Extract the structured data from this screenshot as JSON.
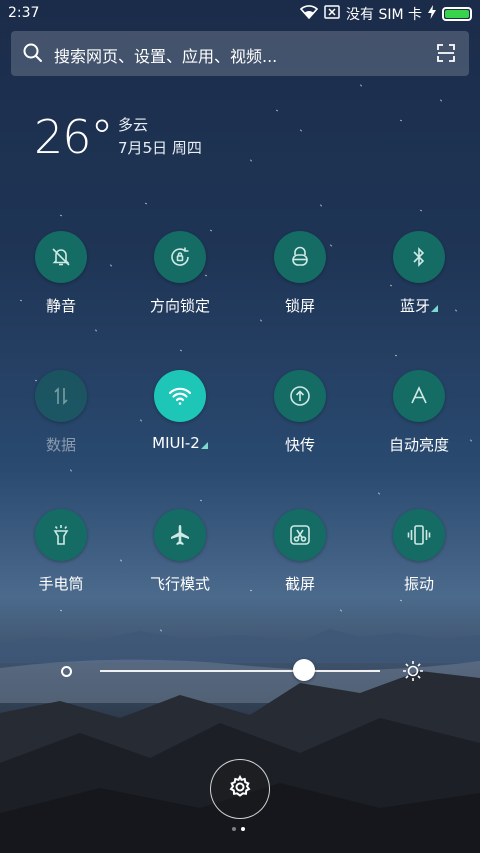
{
  "status_bar": {
    "time": "2:37",
    "sim_status": "没有 SIM 卡",
    "battery_level": 1.0,
    "icons": [
      "wifi-icon",
      "no-sim-icon",
      "charging-icon",
      "battery-icon"
    ]
  },
  "search": {
    "placeholder": "搜索网页、设置、应用、视频...",
    "icons": [
      "search-icon",
      "scan-icon"
    ]
  },
  "weather": {
    "temperature": "26°",
    "condition": "多云",
    "date": "7月5日 周四"
  },
  "toggles": [
    {
      "label": "静音",
      "icon": "silent-bell-icon",
      "state": "off"
    },
    {
      "label": "方向锁定",
      "icon": "rotation-lock-icon",
      "state": "off"
    },
    {
      "label": "锁屏",
      "icon": "lock-icon",
      "state": "off"
    },
    {
      "label": "蓝牙",
      "icon": "bluetooth-icon",
      "state": "off",
      "has_more": true
    },
    {
      "label": "数据",
      "icon": "mobile-data-icon",
      "state": "disabled"
    },
    {
      "label": "MIUI-2",
      "icon": "wifi-icon",
      "state": "on",
      "has_more": true
    },
    {
      "label": "快传",
      "icon": "quick-transfer-icon",
      "state": "off"
    },
    {
      "label": "自动亮度",
      "icon": "auto-brightness-icon",
      "state": "off"
    },
    {
      "label": "手电筒",
      "icon": "flashlight-icon",
      "state": "off"
    },
    {
      "label": "飞行模式",
      "icon": "airplane-icon",
      "state": "off"
    },
    {
      "label": "截屏",
      "icon": "screenshot-icon",
      "state": "off"
    },
    {
      "label": "振动",
      "icon": "vibrate-icon",
      "state": "off"
    }
  ],
  "brightness": {
    "level": 0.73,
    "icons": [
      "brightness-low-icon",
      "brightness-high-icon"
    ]
  },
  "settings": {
    "icon": "gear-icon"
  },
  "pager": {
    "pages": 2,
    "current": 2
  },
  "colors": {
    "toggle_off": "#146c64",
    "toggle_on": "#1ec6b8",
    "battery": "#3ad34c"
  }
}
